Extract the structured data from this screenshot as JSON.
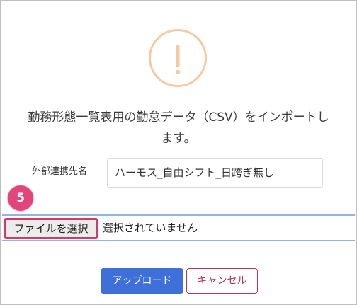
{
  "dialog": {
    "icon": "exclamation-icon",
    "icon_color": "#f8c8a0",
    "message_line1": "勤務形態一覧表用の勤怠データ（CSV）をインポートし",
    "message_line2": "ます。"
  },
  "form": {
    "external_name_label": "外部連携先名",
    "external_name_value": "ハーモス_自由シフト_日跨ぎ無し",
    "file_button_label": "ファイルを選択",
    "file_status": "選択されていません"
  },
  "step_badge": "5",
  "actions": {
    "upload_label": "アップロード",
    "cancel_label": "キャンセル"
  },
  "colors": {
    "primary": "#3f6fd8",
    "danger": "#b8325a",
    "highlight": "#d63869"
  }
}
